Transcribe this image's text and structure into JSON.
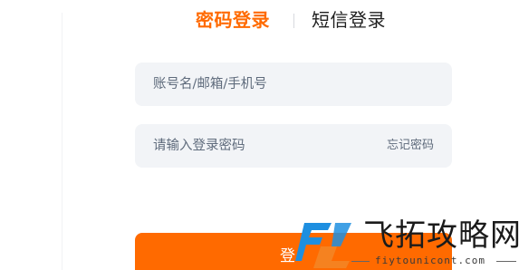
{
  "tabs": {
    "password_login": "密码登录",
    "sms_login": "短信登录",
    "active": "password_login"
  },
  "account_field": {
    "placeholder": "账号名/邮箱/手机号",
    "value": ""
  },
  "password_field": {
    "placeholder": "请输入登录密码",
    "value": "",
    "forgot_label": "忘记密码"
  },
  "login_button": {
    "label_visible": "登"
  },
  "watermark": {
    "site_name": "飞拓攻略网",
    "url": "fiytounicont.com"
  },
  "colors": {
    "accent": "#ff6a00",
    "field_bg": "#f2f4f7",
    "logo_blue": "#1e8fe0",
    "logo_orange": "#f58220"
  }
}
